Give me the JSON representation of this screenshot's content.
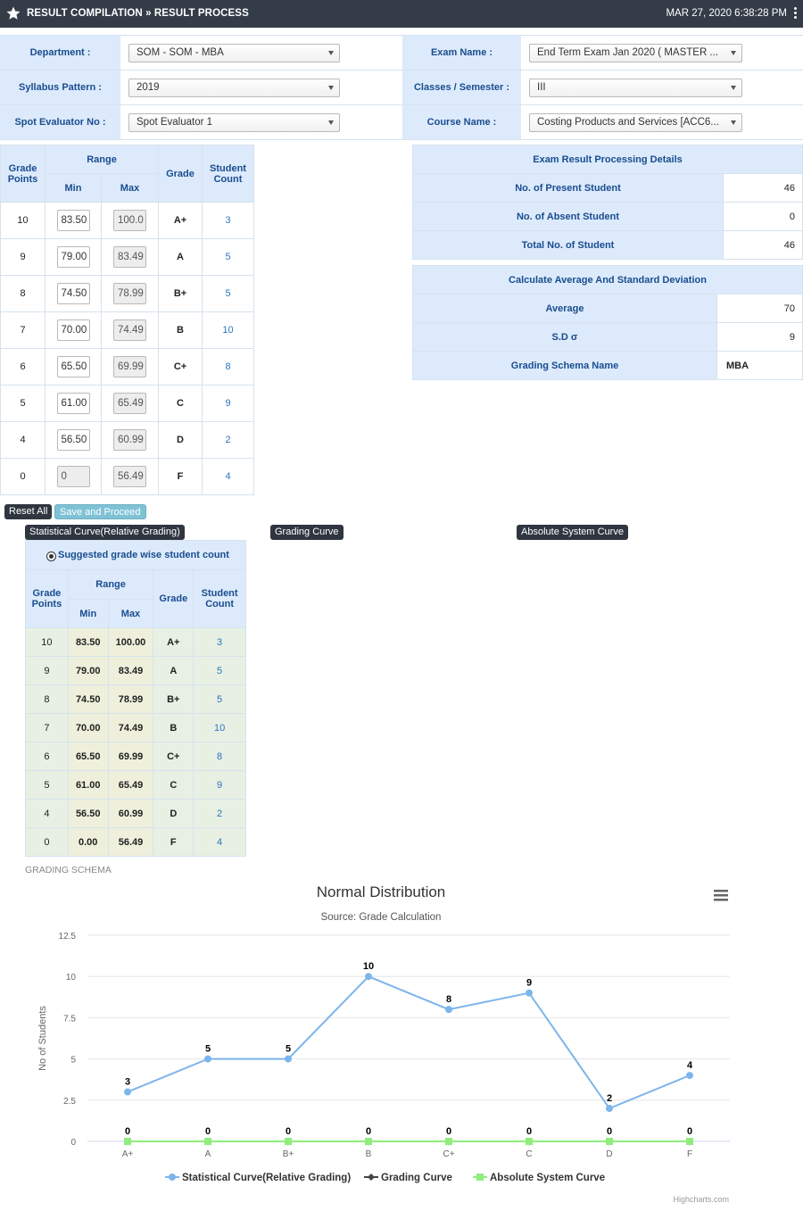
{
  "header": {
    "title": "RESULT COMPILATION » RESULT PROCESS",
    "datetime": "MAR 27, 2020  6:38:28 PM"
  },
  "filters": {
    "department_label": "Department :",
    "department_value": "SOM - SOM - MBA",
    "syllabus_label": "Syllabus Pattern :",
    "syllabus_value": "2019",
    "spot_label": "Spot Evaluator No :",
    "spot_value": "Spot Evaluator 1",
    "exam_label": "Exam Name :",
    "exam_value": "End Term Exam Jan 2020 ( MASTER ...",
    "classes_label": "Classes / Semester :",
    "classes_value": "III",
    "course_label": "Course Name :",
    "course_value": "Costing Products and Services [ACC6..."
  },
  "grade_table": {
    "headers": {
      "grade_points": "Grade Points",
      "range": "Range",
      "min": "Min",
      "max": "Max",
      "grade": "Grade",
      "student_count": "Student Count"
    },
    "rows": [
      {
        "points": "10",
        "min": "83.50",
        "max": "100.0",
        "grade": "A+",
        "count": "3"
      },
      {
        "points": "9",
        "min": "79.00",
        "max": "83.49",
        "grade": "A",
        "count": "5"
      },
      {
        "points": "8",
        "min": "74.50",
        "max": "78.99",
        "grade": "B+",
        "count": "5"
      },
      {
        "points": "7",
        "min": "70.00",
        "max": "74.49",
        "grade": "B",
        "count": "10"
      },
      {
        "points": "6",
        "min": "65.50",
        "max": "69.99",
        "grade": "C+",
        "count": "8"
      },
      {
        "points": "5",
        "min": "61.00",
        "max": "65.49",
        "grade": "C",
        "count": "9"
      },
      {
        "points": "4",
        "min": "56.50",
        "max": "60.99",
        "grade": "D",
        "count": "2"
      },
      {
        "points": "0",
        "min": "0",
        "max": "56.49",
        "grade": "F",
        "count": "4"
      }
    ]
  },
  "exam_details": {
    "title": "Exam Result Processing Details",
    "present_label": "No. of Present Student",
    "present_value": "46",
    "absent_label": "No. of Absent Student",
    "absent_value": "0",
    "total_label": "Total No. of Student",
    "total_value": "46"
  },
  "stats": {
    "title": "Calculate Average And Standard Deviation",
    "average_label": "Average",
    "average_value": "70",
    "sd_label": "S.D  σ",
    "sd_value": "9",
    "schema_label": "Grading Schema Name",
    "schema_value": "MBA"
  },
  "buttons": {
    "reset": "Reset All",
    "save": "Save and Proceed",
    "statistical": "Statistical Curve(Relative Grading)",
    "grading": "Grading Curve",
    "absolute": "Absolute System Curve"
  },
  "suggested": {
    "caption": "Suggested grade wise student count",
    "rows": [
      {
        "points": "10",
        "min": "83.50",
        "max": "100.00",
        "grade": "A+",
        "count": "3"
      },
      {
        "points": "9",
        "min": "79.00",
        "max": "83.49",
        "grade": "A",
        "count": "5"
      },
      {
        "points": "8",
        "min": "74.50",
        "max": "78.99",
        "grade": "B+",
        "count": "5"
      },
      {
        "points": "7",
        "min": "70.00",
        "max": "74.49",
        "grade": "B",
        "count": "10"
      },
      {
        "points": "6",
        "min": "65.50",
        "max": "69.99",
        "grade": "C+",
        "count": "8"
      },
      {
        "points": "5",
        "min": "61.00",
        "max": "65.49",
        "grade": "C",
        "count": "9"
      },
      {
        "points": "4",
        "min": "56.50",
        "max": "60.99",
        "grade": "D",
        "count": "2"
      },
      {
        "points": "0",
        "min": "0.00",
        "max": "56.49",
        "grade": "F",
        "count": "4"
      }
    ]
  },
  "grading_schema_text": "GRADING SCHEMA",
  "colors": {
    "header_bg": "#333c47",
    "label_bg": "#dceafb",
    "label_text": "#1a4d8f",
    "series_statistical": "#7cb5ec",
    "series_grading": "#434348",
    "series_absolute": "#90ed7d"
  },
  "chart_data": {
    "type": "line",
    "title": "Normal Distribution",
    "subtitle": "Source: Grade Calculation",
    "xlabel": "",
    "ylabel": "No of Students",
    "ylim": [
      0,
      12.5
    ],
    "yticks": [
      "0",
      "2.5",
      "5",
      "7.5",
      "10",
      "12.5"
    ],
    "categories": [
      "A+",
      "A",
      "B+",
      "B",
      "C+",
      "C",
      "D",
      "F"
    ],
    "grid": true,
    "legend_position": "bottom-center",
    "credit": "Highcharts.com",
    "series": [
      {
        "name": "Statistical Curve(Relative Grading)",
        "values": [
          3,
          5,
          5,
          10,
          8,
          9,
          2,
          4
        ]
      },
      {
        "name": "Grading Curve",
        "values": [
          0,
          0,
          0,
          0,
          0,
          0,
          0,
          0
        ]
      },
      {
        "name": "Absolute System Curve",
        "values": [
          0,
          0,
          0,
          0,
          0,
          0,
          0,
          0
        ]
      }
    ]
  }
}
